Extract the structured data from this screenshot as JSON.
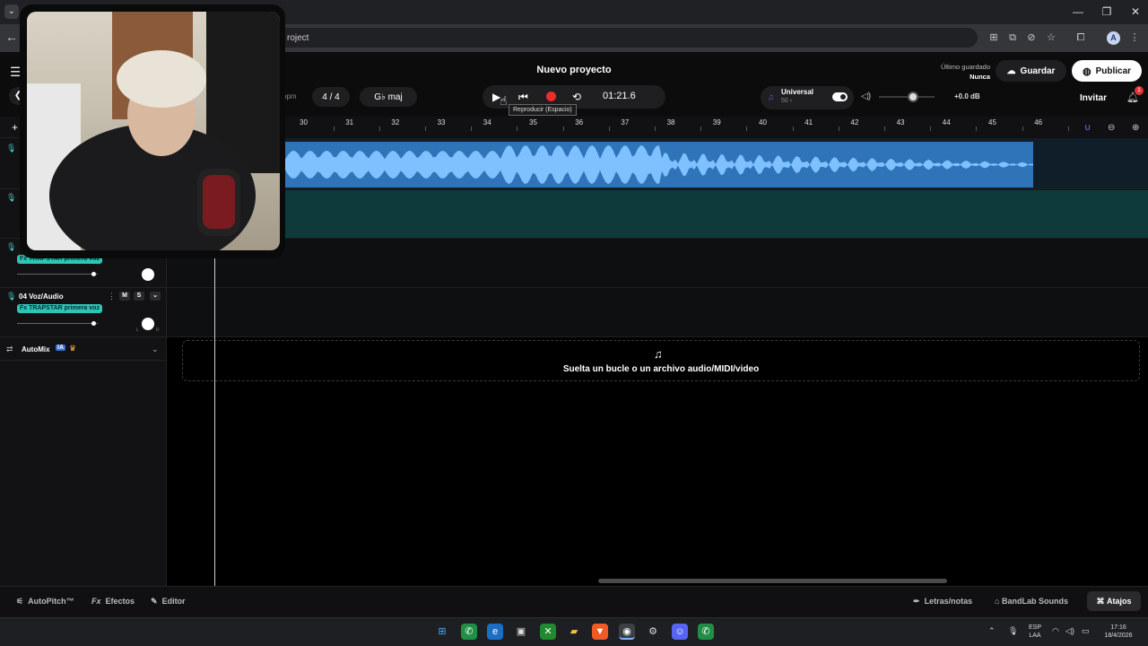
{
  "browser": {
    "url_fragment": "roject"
  },
  "header": {
    "project_title": "Nuevo proyecto",
    "last_saved_label": "Último guardado",
    "last_saved_value": "Nunca",
    "save_label": "Guardar",
    "publish_label": "Publicar",
    "invite_label": "Invitar",
    "notification_count": "1"
  },
  "toolbar": {
    "bpm_label": "bpm",
    "time_signature": "4 / 4",
    "key": "G♭ maj",
    "time": "01:21.6",
    "tooltip": "Reproducir (Espacio)",
    "universal_label": "Universal",
    "universal_sub": "50 ›",
    "volume_db": "+0.0 dB",
    "volume_level": 0.62
  },
  "ruler": {
    "bars": [
      "30",
      "31",
      "32",
      "33",
      "34",
      "35",
      "36",
      "37",
      "38",
      "39",
      "40",
      "41",
      "42",
      "43",
      "44",
      "45",
      "46"
    ]
  },
  "tracks": [
    {
      "fx": "Fx TRAPSTAR primera voz"
    },
    {
      "name": "04  Voz/Audio",
      "fx": "Fx TRAPSTAR primera voz",
      "mute": "M",
      "solo": "S"
    }
  ],
  "automix": {
    "label": "AutoMix",
    "badge": "IA"
  },
  "dropzone": {
    "text": "Suelta un bucle o un archivo audio/MIDI/video"
  },
  "bottom_bar": {
    "autopitch": "AutoPitch™",
    "effects": "Efectos",
    "editor": "Editor",
    "lyrics": "Letras/notas",
    "sounds": "BandLab Sounds",
    "shortcuts": "Atajos"
  },
  "taskbar": {
    "lang_top": "ESP",
    "lang_bottom": "LAA",
    "time": "17:16",
    "date": "18/4/2026"
  },
  "colors": {
    "clip_blue": "#2f73b8",
    "wave_light": "#7fc1ff",
    "teal_tag": "#2ec4b6",
    "record_red": "#ef2b2b"
  }
}
